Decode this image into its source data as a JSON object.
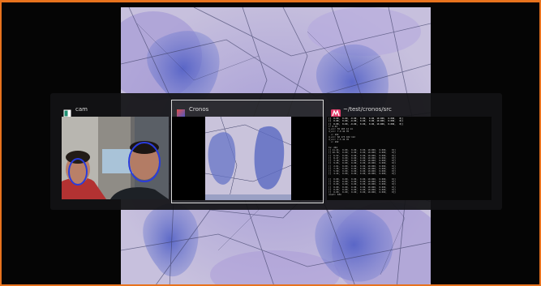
{
  "switcher": {
    "windows": [
      {
        "title": "cam",
        "icon": "camera-app-icon",
        "selected": false
      },
      {
        "title": "Cronos",
        "icon": "cronos-app-icon",
        "selected": true
      },
      {
        "title": "~/test/cronos/src",
        "icon": "terminal-m-icon",
        "selected": false
      }
    ]
  },
  "colors": {
    "frame_border": "#e8731e",
    "wallpaper_base": "#c4bcd8",
    "stain": "#6f78cc",
    "face_ring": "#2a3cdc",
    "switcher_bg": "#121214"
  },
  "terminal": {
    "lines": [
      "[[  0.00,  0.00, -0.00,  0.00,  0.00, 10.000,  0.000,   0]]",
      "[[  0.00,  0.00, -0.00,  0.00,  0.00, 10.000,  0.000,   0]]",
      "[[  0.00,  0.00, -0.00,  0.00,  0.00, 10.000,  0.000,   0]]",
      "x: 0.03",
      "h_src: 55 103 14 14",
      "d_src: 7.0 44 78",
      "  x: 202",
      "d_src: 60 173 102 112",
      "d_src: 7.5 44 78",
      "  x: 202",
      "",
      "ts: 204",
      "[[ 11.24,  0.00,  0.00,  0.00, 10.000,  0.000,    0]]",
      "[[ 10.78,  0.00,  0.00,  0.00, 10.000,  0.000,    0]]",
      "[[  6.52,  0.00,  0.00,  0.00, 10.000,  0.000,    0]]",
      "[[  8.47,  0.00,  0.00,  0.00, 10.000,  0.000,    0]]",
      "[[  3.18,  0.00,  0.00,  0.00, 10.000,  0.000,    0]]",
      "[[  9.06,  0.00,  0.00,  0.00, 10.000,  0.000,    0]]",
      "[[  2.61,  0.00,  0.00,  0.00, 10.000,  0.000,    0]]",
      "[[  7.35,  0.00,  0.00,  0.00, 10.000,  0.000,    0]]",
      "[[  5.90,  0.00,  0.00,  0.00, 10.000,  0.000,    0]]",
      "[[  4.44,  0.00,  0.00,  0.00, 10.000,  0.000,    0]]",
      "",
      "[[  0.00,  0.00,  0.00,  0.00, 10.000,  0.000,    0]]",
      "[[  0.00,  0.00,  0.00,  0.00, 10.000,  0.000,    0]]",
      "[[  0.00,  0.00,  0.00,  0.00, 10.000,  0.000,    0]]",
      "[[  0.00,  0.00,  0.00,  0.00, 10.000,  0.000,    0]]",
      "[[  0.00,  0.00,  0.00,  0.00, 10.000,  0.000,    0]]",
      "[[  0.00,  0.00,  0.00,  0.00, 10.000,  0.000,    0]]",
      "count: 634"
    ]
  }
}
